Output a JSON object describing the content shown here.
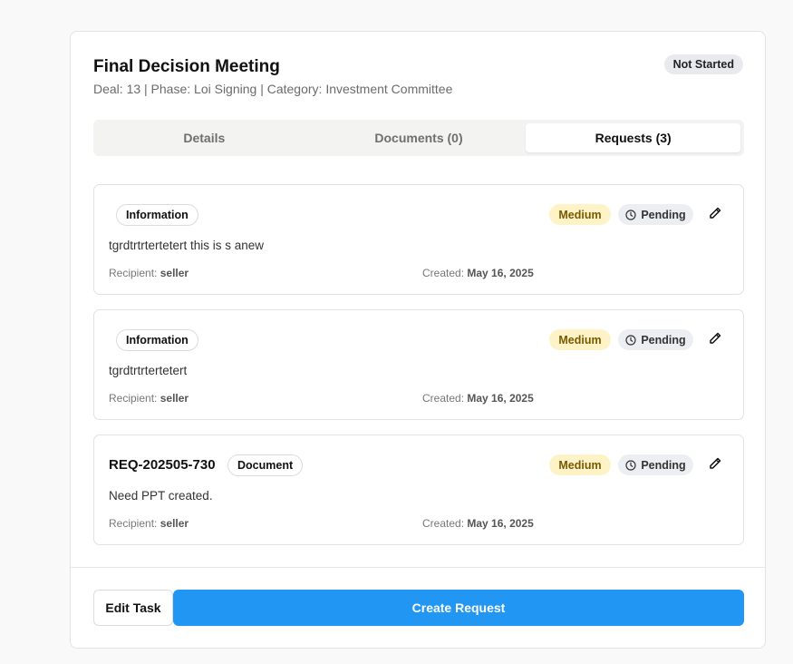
{
  "task": {
    "title": "Final Decision Meeting",
    "subtitle": "Deal: 13 | Phase: Loi Signing | Category: Investment Committee",
    "status": "Not Started"
  },
  "tabs": [
    {
      "label": "Details"
    },
    {
      "label": "Documents (0)"
    },
    {
      "label": "Requests (3)"
    }
  ],
  "active_tab": "Requests (3)",
  "requests": [
    {
      "id": "",
      "type": "Information",
      "priority": "Medium",
      "status": "Pending",
      "description": "tgrdtrtrtertetert this is s anew",
      "recipient_label": "Recipient:",
      "recipient": "seller",
      "created_label": "Created:",
      "created": "May 16, 2025"
    },
    {
      "id": "",
      "type": "Information",
      "priority": "Medium",
      "status": "Pending",
      "description": "tgrdtrtrtertetert",
      "recipient_label": "Recipient:",
      "recipient": "seller",
      "created_label": "Created:",
      "created": "May 16, 2025"
    },
    {
      "id": "REQ-202505-730",
      "type": "Document",
      "priority": "Medium",
      "status": "Pending",
      "description": "Need PPT created.",
      "recipient_label": "Recipient:",
      "recipient": "seller",
      "created_label": "Created:",
      "created": "May 16, 2025"
    }
  ],
  "footer": {
    "edit_label": "Edit Task",
    "create_label": "Create Request"
  },
  "colors": {
    "accent": "#2196f3",
    "priority_bg": "#fdf3c6",
    "pending_bg": "#eceef1"
  },
  "icons": {
    "pending": "clock-icon",
    "edit": "pencil-icon"
  }
}
